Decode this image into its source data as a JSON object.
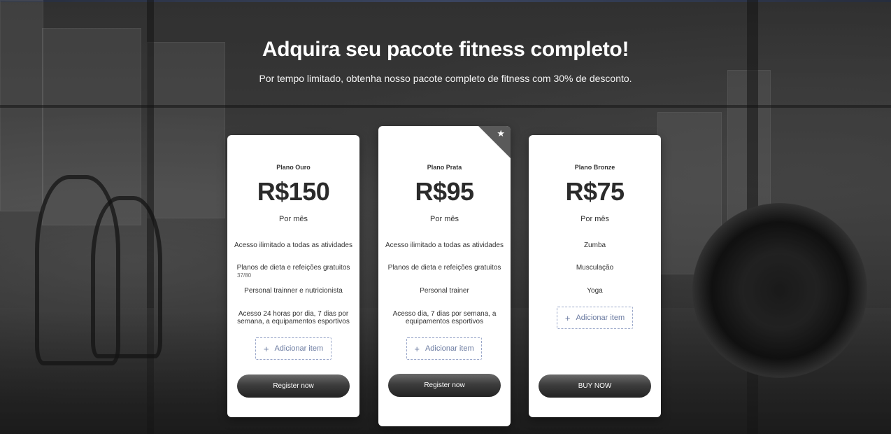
{
  "header": {
    "title": "Adquira seu pacote fitness completo!",
    "subtitle": "Por tempo limitado, obtenha nosso pacote completo de fitness com 30% de desconto."
  },
  "plans": [
    {
      "name": "Plano Ouro",
      "price": "R$150",
      "period": "Por mês",
      "features": [
        "Acesso ilimitado a todas as atividades",
        "Planos de dieta e refeições gratuitos",
        "Personal trainner e nutricionista",
        "Acesso 24 horas por dia, 7 dias por semana, a equipamentos esportivos"
      ],
      "char_counter": "37/80",
      "add_item_label": "Adicionar item",
      "cta_label": "Register now"
    },
    {
      "name": "Plano Prata",
      "price": "R$95",
      "period": "Por mês",
      "featured_icon": "star-icon",
      "features": [
        "Acesso ilimitado a todas as atividades",
        "Planos de dieta e refeições gratuitos",
        "Personal trainer",
        "Acesso  dia, 7 dias por semana, a equipamentos esportivos"
      ],
      "add_item_label": "Adicionar item",
      "cta_label": "Register now"
    },
    {
      "name": "Plano Bronze",
      "price": "R$75",
      "period": "Por mês",
      "features": [
        "Zumba",
        "Musculação",
        "Yoga"
      ],
      "add_item_label": "Adicionar item",
      "cta_label": "BUY NOW"
    }
  ],
  "colors": {
    "card_bg": "#ffffff",
    "button_dark": "#2b2b2b",
    "dashed_border": "#9aa7c9",
    "ribbon": "#5a5a5a"
  }
}
